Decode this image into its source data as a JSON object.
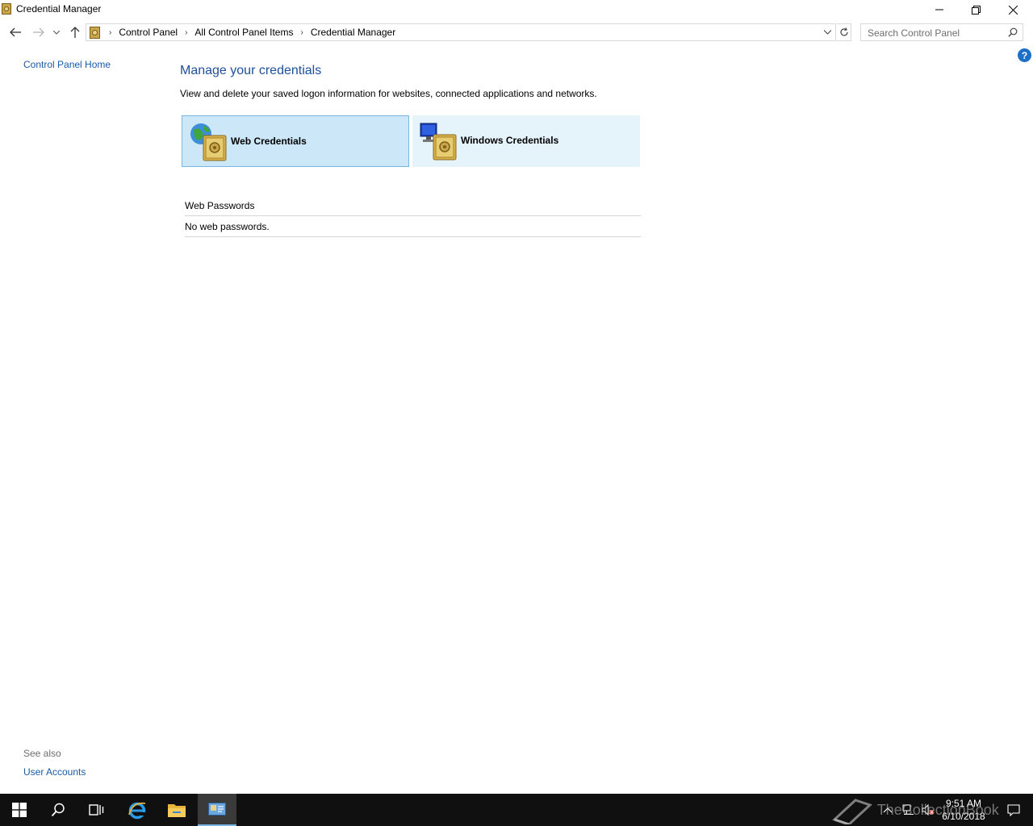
{
  "window": {
    "title": "Credential Manager",
    "icon": "credential-manager-icon"
  },
  "address": {
    "breadcrumbs": [
      "Control Panel",
      "All Control Panel Items",
      "Credential Manager"
    ],
    "search_placeholder": "Search Control Panel"
  },
  "sidebar": {
    "home_link": "Control Panel Home",
    "see_also_heading": "See also",
    "see_also_links": [
      "User Accounts"
    ]
  },
  "main": {
    "title": "Manage your credentials",
    "description": "View and delete your saved logon information for websites, connected applications and networks.",
    "tiles": [
      {
        "label": "Web Credentials",
        "icon": "web-credentials-vault-icon",
        "selected": true
      },
      {
        "label": "Windows Credentials",
        "icon": "windows-credentials-vault-icon",
        "selected": false
      }
    ],
    "section": {
      "heading": "Web Passwords",
      "empty_text": "No web passwords."
    },
    "help": "?"
  },
  "taskbar": {
    "time": "9:51 AM",
    "date": "6/10/2018",
    "apps": [
      "start-icon",
      "search-icon",
      "task-view-icon",
      "internet-explorer-icon",
      "file-explorer-icon",
      "credential-manager-icon"
    ]
  },
  "watermark": "TheCollectionBook",
  "colors": {
    "link": "#1a5aa6",
    "title": "#1f4e9a",
    "tile_bg": "#e5f3fb",
    "tile_selected_bg": "#cce8f8",
    "taskbar": "#101010"
  }
}
